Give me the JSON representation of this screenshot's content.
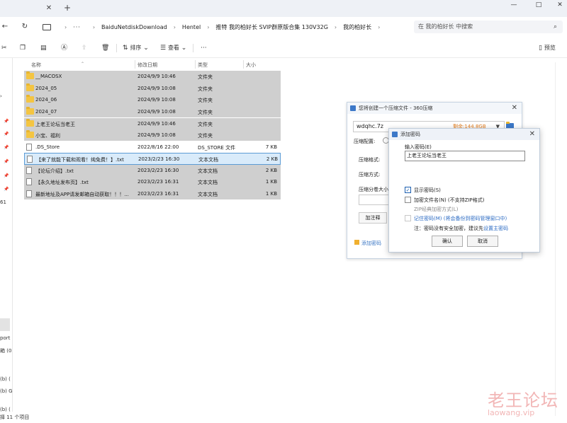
{
  "window": {
    "tab_close": "✕",
    "tab_add": "+",
    "controls": [
      "—",
      "□",
      "✕"
    ]
  },
  "address": {
    "back": "←",
    "refresh": "↻",
    "more": "···",
    "crumbs": [
      "BaiduNetdiskDownload",
      "Hentel",
      "推特 我的柏好长 SVIP群原版合集 130V32G",
      "我的柏好长"
    ],
    "search_placeholder": "在 我的柏好长 中搜索"
  },
  "commandbar": {
    "sort_label": "排序",
    "view_label": "查看",
    "more": "···",
    "preview_label": "预览"
  },
  "leftpane": {
    "fragments": [
      "port",
      "箱 (0",
      "(b) (",
      "(b) G",
      "(b) (",
      "61"
    ],
    "status": "择 11 个项目"
  },
  "filelist": {
    "columns": [
      "名称",
      "修改日期",
      "类型",
      "大小"
    ],
    "rows": [
      {
        "name": "__MACOSX",
        "date": "2024/9/9 10:46",
        "type": "文件夹",
        "size": "",
        "kind": "folder",
        "state": "hl"
      },
      {
        "name": "2024_05",
        "date": "2024/9/9 10:08",
        "type": "文件夹",
        "size": "",
        "kind": "folder",
        "state": "hl"
      },
      {
        "name": "2024_06",
        "date": "2024/9/9 10:08",
        "type": "文件夹",
        "size": "",
        "kind": "folder",
        "state": "hl"
      },
      {
        "name": "2024_07",
        "date": "2024/9/9 10:08",
        "type": "文件夹",
        "size": "",
        "kind": "folder",
        "state": "hl"
      },
      {
        "name": "上老王论坛当老王",
        "date": "2024/9/9 10:46",
        "type": "文件夹",
        "size": "",
        "kind": "folder",
        "state": "hl"
      },
      {
        "name": "小宝、福利",
        "date": "2024/9/9 10:08",
        "type": "文件夹",
        "size": "",
        "kind": "folder",
        "state": "hl"
      },
      {
        "name": ".DS_Store",
        "date": "2022/8/16 22:00",
        "type": "DS_STORE 文件",
        "size": "7 KB",
        "kind": "file",
        "state": ""
      },
      {
        "name": "【来了就能下载和观看！纯免费！】.txt",
        "date": "2023/2/23 16:30",
        "type": "文本文档",
        "size": "2 KB",
        "kind": "file",
        "state": "focus"
      },
      {
        "name": "【论坛介绍】.txt",
        "date": "2023/2/23 16:30",
        "type": "文本文档",
        "size": "2 KB",
        "kind": "file",
        "state": "hl"
      },
      {
        "name": "【永久地址发布页】.txt",
        "date": "2023/2/23 16:31",
        "type": "文本文档",
        "size": "1 KB",
        "kind": "file",
        "state": "hl"
      },
      {
        "name": "最新地址及APP请发邮箱自动获取！！！...",
        "date": "2023/2/23 16:31",
        "type": "文本文档",
        "size": "1 KB",
        "kind": "file",
        "state": "hl"
      }
    ]
  },
  "compress_dialog": {
    "title": "您将创建一个压缩文件 - 360压缩",
    "close": "✕",
    "filename": "wdqhc.7z",
    "free_space": "剩余:144.8GB",
    "dropdown": "▼",
    "config_label": "压缩配置:",
    "format_label": "压缩格式:",
    "method_label": "压缩方式:",
    "split_label": "压缩分卷大小",
    "options_button": "加注释",
    "add_password_link": "添加密码"
  },
  "password_dialog": {
    "title": "添加密码",
    "close": "✕",
    "input_label": "输入密码(E)",
    "password_value": "上老王论坛当老王",
    "show_password": "显示密码(S)",
    "encrypt_names": "加密文件名(N) (不支持ZIP格式)",
    "zip_legacy": "ZIP经典加密方式(L)",
    "remember_password": "记住密码(M) (将会备份到密码管理窗口中)",
    "note_prefix": "注：密码没有安全加密，建议先",
    "note_link": "设置主密码",
    "ok": "确认",
    "cancel": "取消",
    "checked_mark": "✓"
  },
  "watermark": {
    "cn": "老王论坛",
    "en": "laowang.vip"
  },
  "colors": {
    "selection": "#cfcfcf",
    "focus": "#d9ebfa",
    "folder": "#f4c542",
    "link": "#2a6ac3",
    "watermark": "#f2b6b6"
  }
}
